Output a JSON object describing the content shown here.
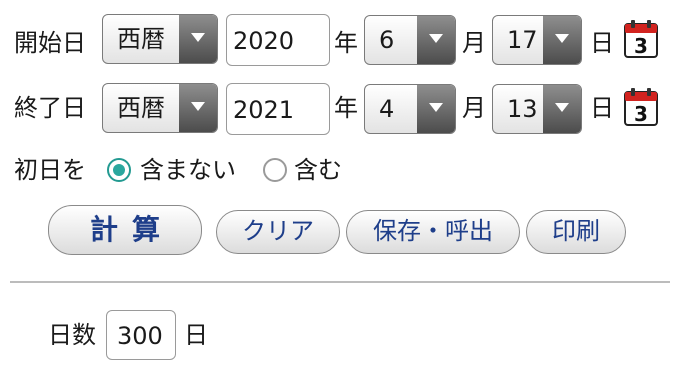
{
  "start_row": {
    "label": "開始日",
    "era": "西暦",
    "year": "2020",
    "year_unit": "年",
    "month": "6",
    "month_unit": "月",
    "day": "17",
    "day_unit": "日",
    "calendar_icon_number": "3"
  },
  "end_row": {
    "label": "終了日",
    "era": "西暦",
    "year": "2021",
    "year_unit": "年",
    "month": "4",
    "month_unit": "月",
    "day": "13",
    "day_unit": "日",
    "calendar_icon_number": "3"
  },
  "first_day": {
    "label": "初日を",
    "options": [
      {
        "label": "含まない",
        "selected": true
      },
      {
        "label": "含む",
        "selected": false
      }
    ]
  },
  "buttons": {
    "calculate": "計算",
    "clear": "クリア",
    "save_load": "保存・呼出",
    "print": "印刷"
  },
  "result": {
    "label": "日数",
    "value": "300",
    "unit": "日"
  },
  "colors": {
    "button_text": "#1e3e8a",
    "radio_accent": "#2aa79e",
    "calendar_red": "#d2231f"
  }
}
